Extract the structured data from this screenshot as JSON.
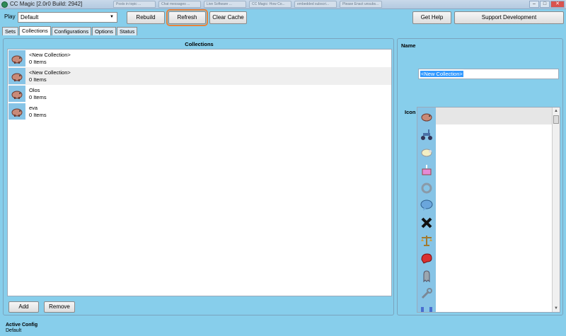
{
  "window": {
    "title": "CC Magic [2.0r0 Build: 2942]",
    "background_tabs": [
      "Posts in topic ...",
      "Chat messages ...",
      "Live Software ...",
      "CC Magic: How Co...",
      "embedded subscri...",
      "Please Enact unsubs..."
    ],
    "controls": [
      "–",
      "□",
      "✕"
    ]
  },
  "toolbar": {
    "play_label": "Play",
    "config_value": "Default",
    "rebuild_label": "Rebuild",
    "refresh_label": "Refresh",
    "clear_cache_label": "Clear Cache",
    "get_help_label": "Get Help",
    "support_label": "Support Development"
  },
  "tabs": [
    {
      "label": "Sets",
      "active": false
    },
    {
      "label": "Collections",
      "active": true
    },
    {
      "label": "Configurations",
      "active": false
    },
    {
      "label": "Options",
      "active": false
    },
    {
      "label": "Status",
      "active": false
    }
  ],
  "collections": {
    "header": "Collections",
    "items": [
      {
        "name": "<New Collection>",
        "count": "0 Items"
      },
      {
        "name": "<New Collection>",
        "count": "0 Items"
      },
      {
        "name": "Olos",
        "count": "0 Items"
      },
      {
        "name": "eva",
        "count": "0 Items"
      }
    ],
    "add_label": "Add",
    "remove_label": "Remove"
  },
  "detail": {
    "name_label": "Name",
    "name_value": "<New Collection>",
    "icon_label": "Icon",
    "icons": [
      "piggy-bank-icon",
      "scooter-icon",
      "sheep-icon",
      "cake-icon",
      "ring-icon",
      "speech-bubble-icon",
      "x-mark-icon",
      "scales-icon",
      "boxing-glove-icon",
      "ghost-icon",
      "wrench-icon",
      "magnet-icon"
    ]
  },
  "status": {
    "label": "Active Config",
    "value": "Default"
  },
  "colors": {
    "background": "#87ceeb",
    "highlight": "#e8823a",
    "selection": "#3399ff"
  }
}
